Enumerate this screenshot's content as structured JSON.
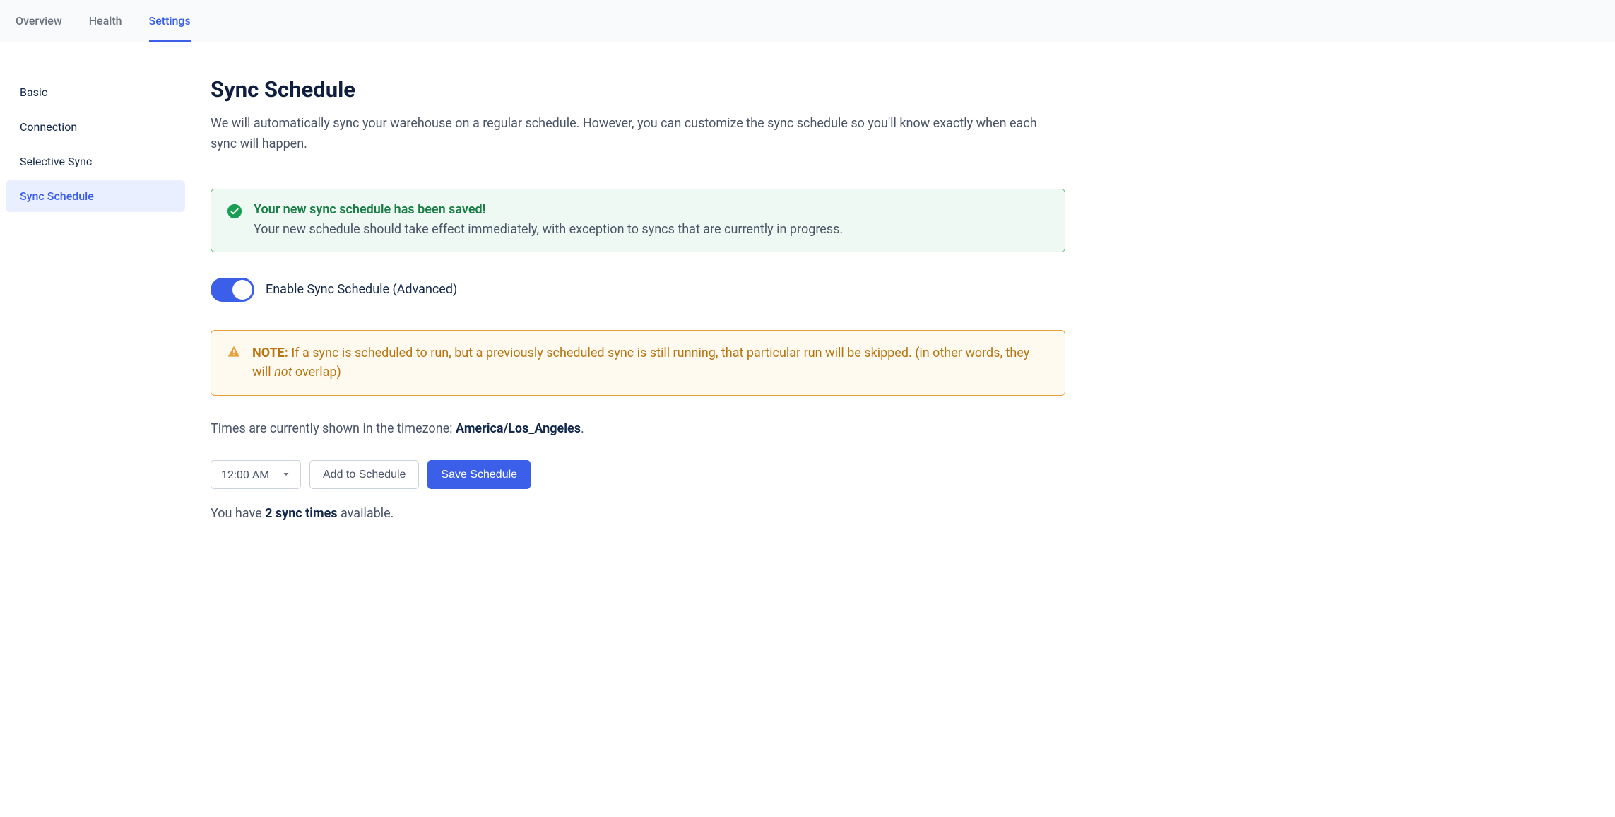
{
  "topNav": {
    "items": [
      {
        "label": "Overview",
        "active": false
      },
      {
        "label": "Health",
        "active": false
      },
      {
        "label": "Settings",
        "active": true
      }
    ]
  },
  "sidebar": {
    "items": [
      {
        "label": "Basic",
        "active": false
      },
      {
        "label": "Connection",
        "active": false
      },
      {
        "label": "Selective Sync",
        "active": false
      },
      {
        "label": "Sync Schedule",
        "active": true
      }
    ]
  },
  "page": {
    "title": "Sync Schedule",
    "description": "We will automatically sync your warehouse on a regular schedule. However, you can customize the sync schedule so you'll know exactly when each sync will happen."
  },
  "alerts": {
    "success": {
      "title": "Your new sync schedule has been saved!",
      "text": "Your new schedule should take effect immediately, with exception to syncs that are currently in progress."
    },
    "warning": {
      "noteLabel": "NOTE:",
      "text1": " If a sync is scheduled to run, but a previously scheduled sync is still running, that particular run will be skipped. (in other words, they will ",
      "em": "not",
      "text2": " overlap)"
    }
  },
  "toggle": {
    "label": "Enable Sync Schedule (Advanced)",
    "enabled": true
  },
  "timezone": {
    "prefix": "Times are currently shown in the timezone: ",
    "value": "America/Los_Angeles",
    "suffix": "."
  },
  "controls": {
    "timeSelected": "12:00 AM",
    "addLabel": "Add to Schedule",
    "saveLabel": "Save Schedule"
  },
  "available": {
    "prefix": "You have ",
    "count": "2 sync times",
    "suffix": " available."
  }
}
